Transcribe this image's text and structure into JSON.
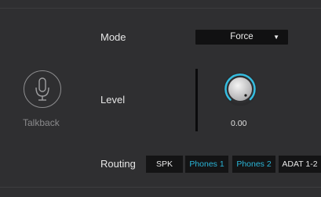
{
  "talkback": {
    "label": "Talkback",
    "icon": "microphone-icon"
  },
  "mode": {
    "label": "Mode",
    "selected": "Force",
    "caret_icon": "chevron-down-icon"
  },
  "level": {
    "label": "Level",
    "value": "0.00",
    "meter_fill": 0.0
  },
  "routing": {
    "label": "Routing",
    "buttons": [
      {
        "label": "SPK",
        "active": false
      },
      {
        "label": "Phones 1",
        "active": true
      },
      {
        "label": "Phones 2",
        "active": true
      },
      {
        "label": "ADAT 1-2",
        "active": false
      }
    ]
  },
  "colors": {
    "background": "#2f2f31",
    "accent": "#2ab5d8",
    "button_bg": "#141415"
  }
}
